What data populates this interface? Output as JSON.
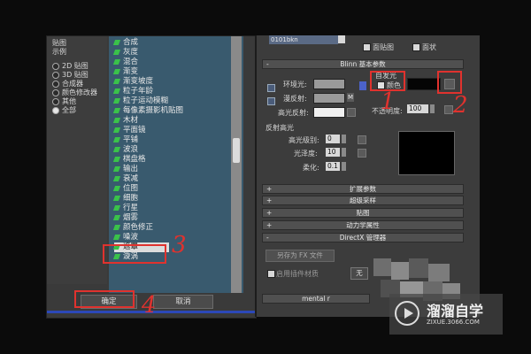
{
  "left_panel": {
    "tree_items_partial": [
      "贴图",
      "示例"
    ],
    "radio_items": [
      {
        "label": "2D 贴图",
        "checked": false
      },
      {
        "label": "3D 贴图",
        "checked": false
      },
      {
        "label": "合成器",
        "checked": false
      },
      {
        "label": "颜色修改器",
        "checked": false
      },
      {
        "label": "其他",
        "checked": false
      },
      {
        "label": "全部",
        "checked": true
      }
    ]
  },
  "map_list": {
    "items": [
      "合成",
      "灰度",
      "混合",
      "渐变",
      "渐变坡度",
      "粒子年龄",
      "粒子运动模糊",
      "每像素摄影机贴图",
      "木材",
      "平面镜",
      "平铺",
      "波浪",
      "棋盘格",
      "输出",
      "衰减",
      "位图",
      "细胞",
      "行星",
      "烟雾",
      "颜色修正",
      "噪波",
      "遮罩",
      "漩涡"
    ],
    "selected_item": "遮罩"
  },
  "dialog_buttons": {
    "ok": "确定",
    "cancel": "取消"
  },
  "right_panel": {
    "material_name": "0101bkn",
    "top_checkboxes": [
      "面贴图",
      "面状"
    ],
    "blinn_rollout_title": "Blinn 基本参数",
    "ambient_label": "环境光:",
    "diffuse_label": "漫反射:",
    "specular_label": "高光反射:",
    "lock_letter": "M",
    "self_illum_label": "自发光",
    "color_checkbox_label": "颜色",
    "opacity_label": "不透明度:",
    "opacity_value": "100",
    "spec_highlights_label": "反射高光",
    "specular_level_label": "高光级别:",
    "specular_level_value": "0",
    "glossiness_label": "光泽度:",
    "glossiness_value": "10",
    "soften_label": "柔化:",
    "soften_value": "0.1",
    "rollouts": [
      {
        "sign": "+",
        "title": "扩展参数"
      },
      {
        "sign": "+",
        "title": "超级采样"
      },
      {
        "sign": "+",
        "title": "贴图"
      },
      {
        "sign": "+",
        "title": "动力学属性"
      },
      {
        "sign": "-",
        "title": "DirectX 管理器"
      }
    ],
    "directx_save_label": "另存为 FX 文件",
    "directx_enable_label": "启用插件材质",
    "directx_dropdown_value": "无",
    "mental_ray_rollout": "mental r"
  },
  "annotations": [
    "1",
    "2",
    "3",
    "4"
  ],
  "watermark": {
    "title": "溜溜自学",
    "url": "ZIXUE.3066.COM"
  },
  "colors": {
    "annotation_red": "#e0322e",
    "list_bg": "#395a6e",
    "map_icon_green": "#3ac24a"
  }
}
